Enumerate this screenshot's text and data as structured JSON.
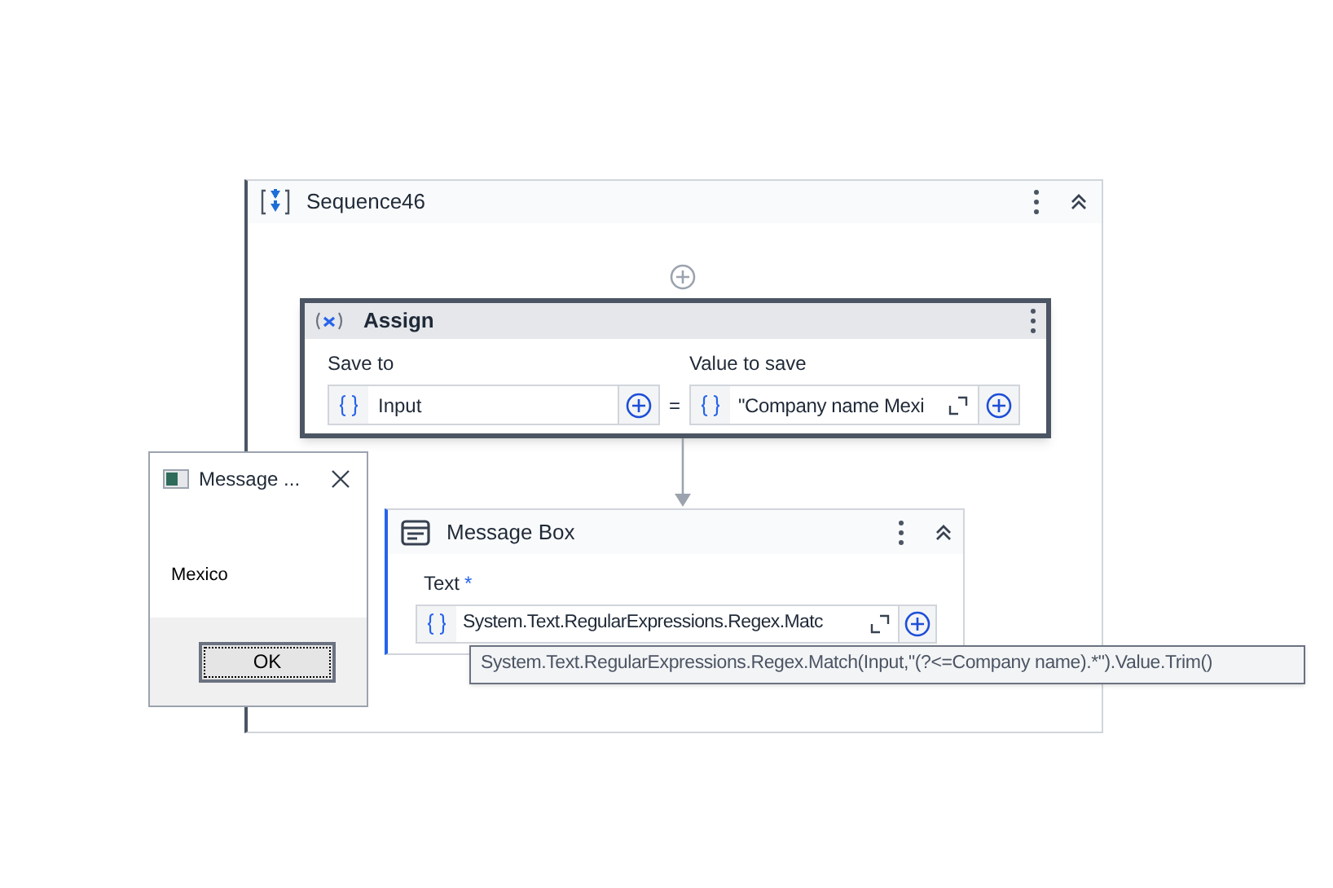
{
  "sequence": {
    "title": "Sequence46"
  },
  "assign": {
    "title": "Assign",
    "save_to": {
      "label": "Save to",
      "value": "Input"
    },
    "operator": "=",
    "value_to_save": {
      "label": "Value to save",
      "value": "\"Company name Mexi"
    }
  },
  "message_box_activity": {
    "title": "Message Box",
    "text_field": {
      "label": "Text",
      "required_mark": "*",
      "value": "System.Text.RegularExpressions.Regex.Matc"
    }
  },
  "tooltip": "System.Text.RegularExpressions.Regex.Match(Input,\"(?<=Company name).*\").Value.Trim()",
  "dialog": {
    "title": "Message ...",
    "message": "Mexico",
    "button": "OK"
  }
}
